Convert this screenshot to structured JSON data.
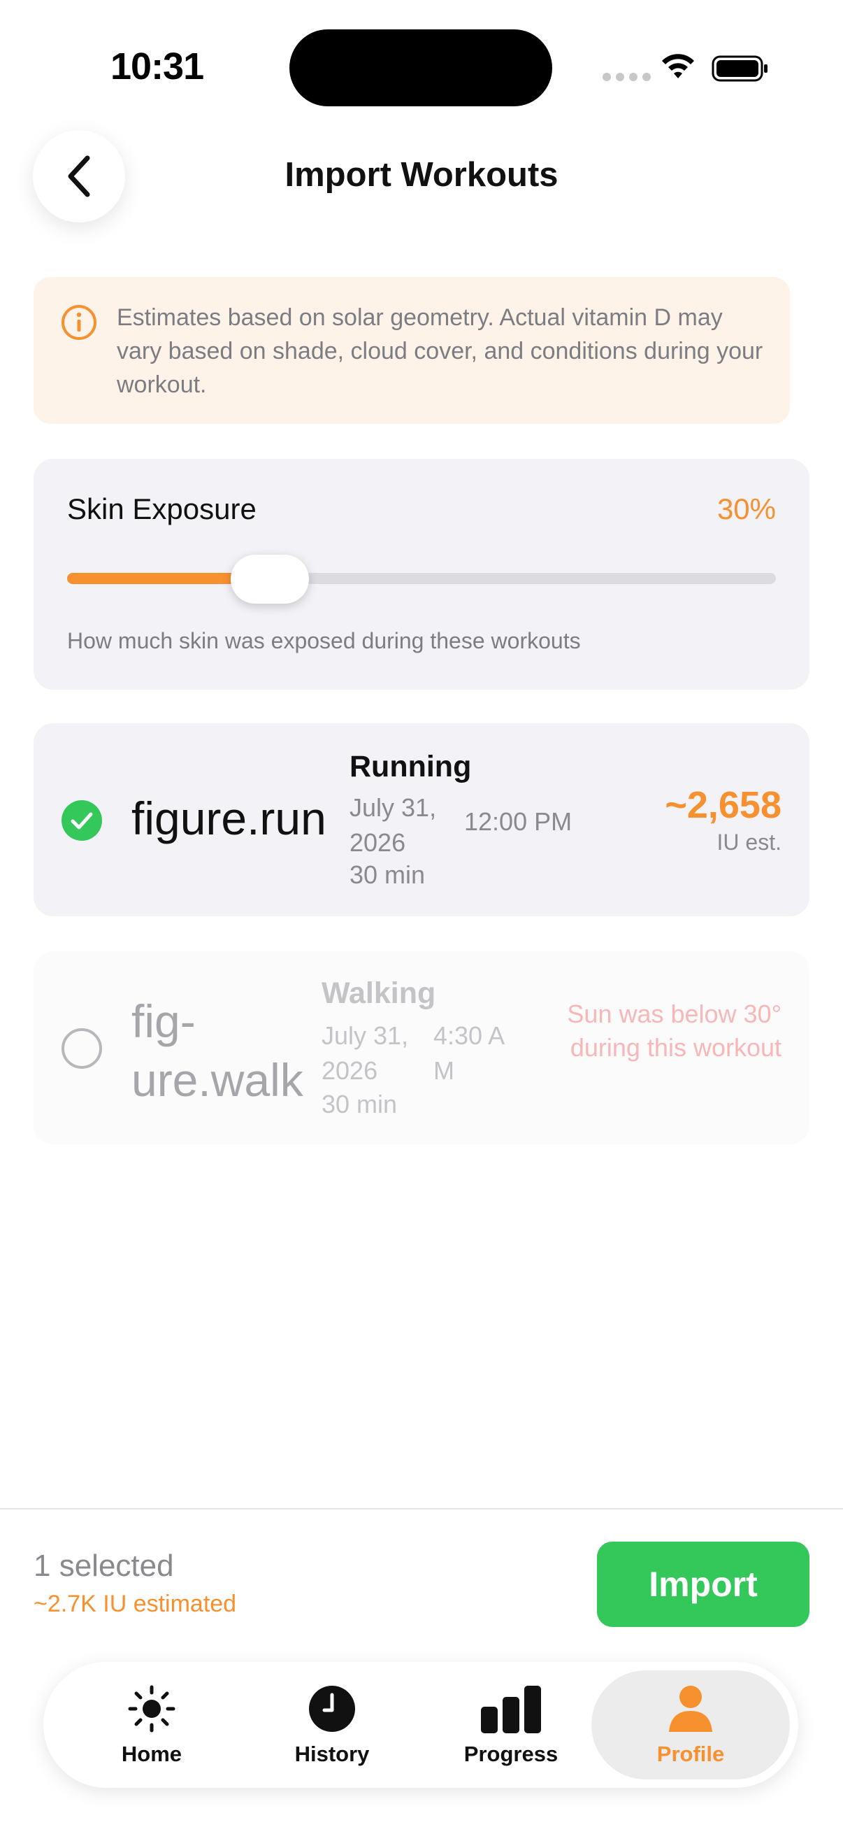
{
  "status_bar": {
    "time": "10:31"
  },
  "header": {
    "title": "Import Workouts"
  },
  "info_banner": {
    "text": "Estimates based on solar geometry. Actual vitamin D may vary based on shade, cloud cover, and conditions during your workout."
  },
  "skin_exposure": {
    "label": "Skin Exposure",
    "value_label": "30%",
    "value_fraction": 0.3,
    "help": "How much skin was exposed during these workouts"
  },
  "workouts": [
    {
      "symbol": "figure.run",
      "type": "Running",
      "date": "July 31, 2026",
      "time": "12:00 PM",
      "duration": "30 min",
      "iu": "~2,658",
      "iu_suffix": "IU est.",
      "selected": true
    },
    {
      "symbol": "fig- ure.walk",
      "type": "Walking",
      "date": "July 31, 2026",
      "time": "4:30 A M",
      "duration": "30 min",
      "note": "Sun was below 30° during this workout",
      "selected": false
    }
  ],
  "footer": {
    "selected_count": "1 selected",
    "iu_estimated": "~2.7K IU estimated",
    "import_label": "Import"
  },
  "tabs": [
    {
      "label": "Home",
      "icon": "sun-icon"
    },
    {
      "label": "History",
      "icon": "clock-icon"
    },
    {
      "label": "Progress",
      "icon": "bar-chart-icon"
    },
    {
      "label": "Profile",
      "icon": "person-icon",
      "active": true
    }
  ],
  "colors": {
    "accent": "#f7902f",
    "success": "#34c759",
    "warning_text": "#f7b7b7"
  }
}
